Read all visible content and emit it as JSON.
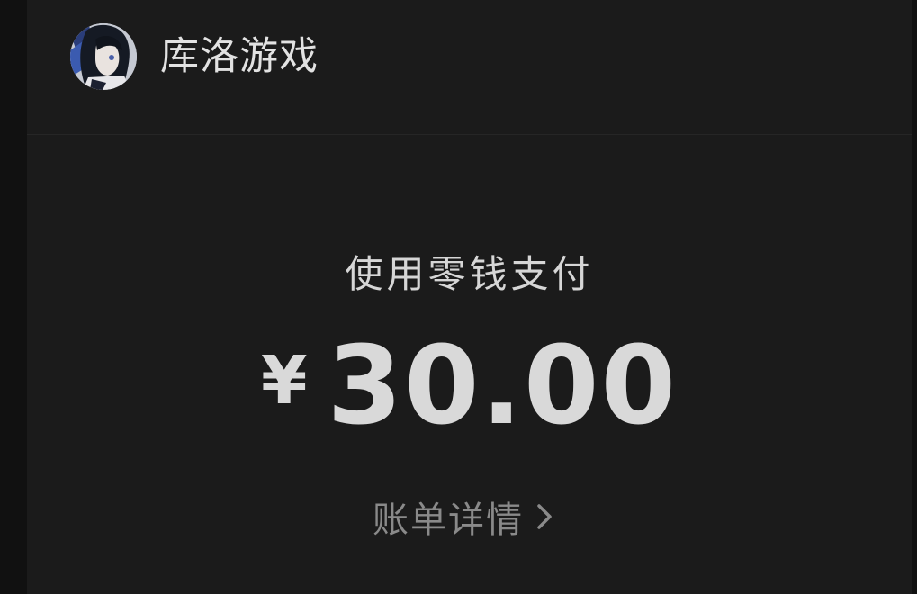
{
  "merchant": {
    "name": "库洛游戏",
    "avatar_icon": "anime-avatar"
  },
  "payment": {
    "method_label": "使用零钱支付",
    "currency_symbol": "¥",
    "amount": "30.00"
  },
  "bill_details": {
    "label": "账单详情",
    "icon": "chevron-right-icon"
  },
  "colors": {
    "background": "#1b1b1b",
    "outer_background": "#111111",
    "primary_text": "#d9d9d9",
    "secondary_text": "#8a8a8a"
  }
}
